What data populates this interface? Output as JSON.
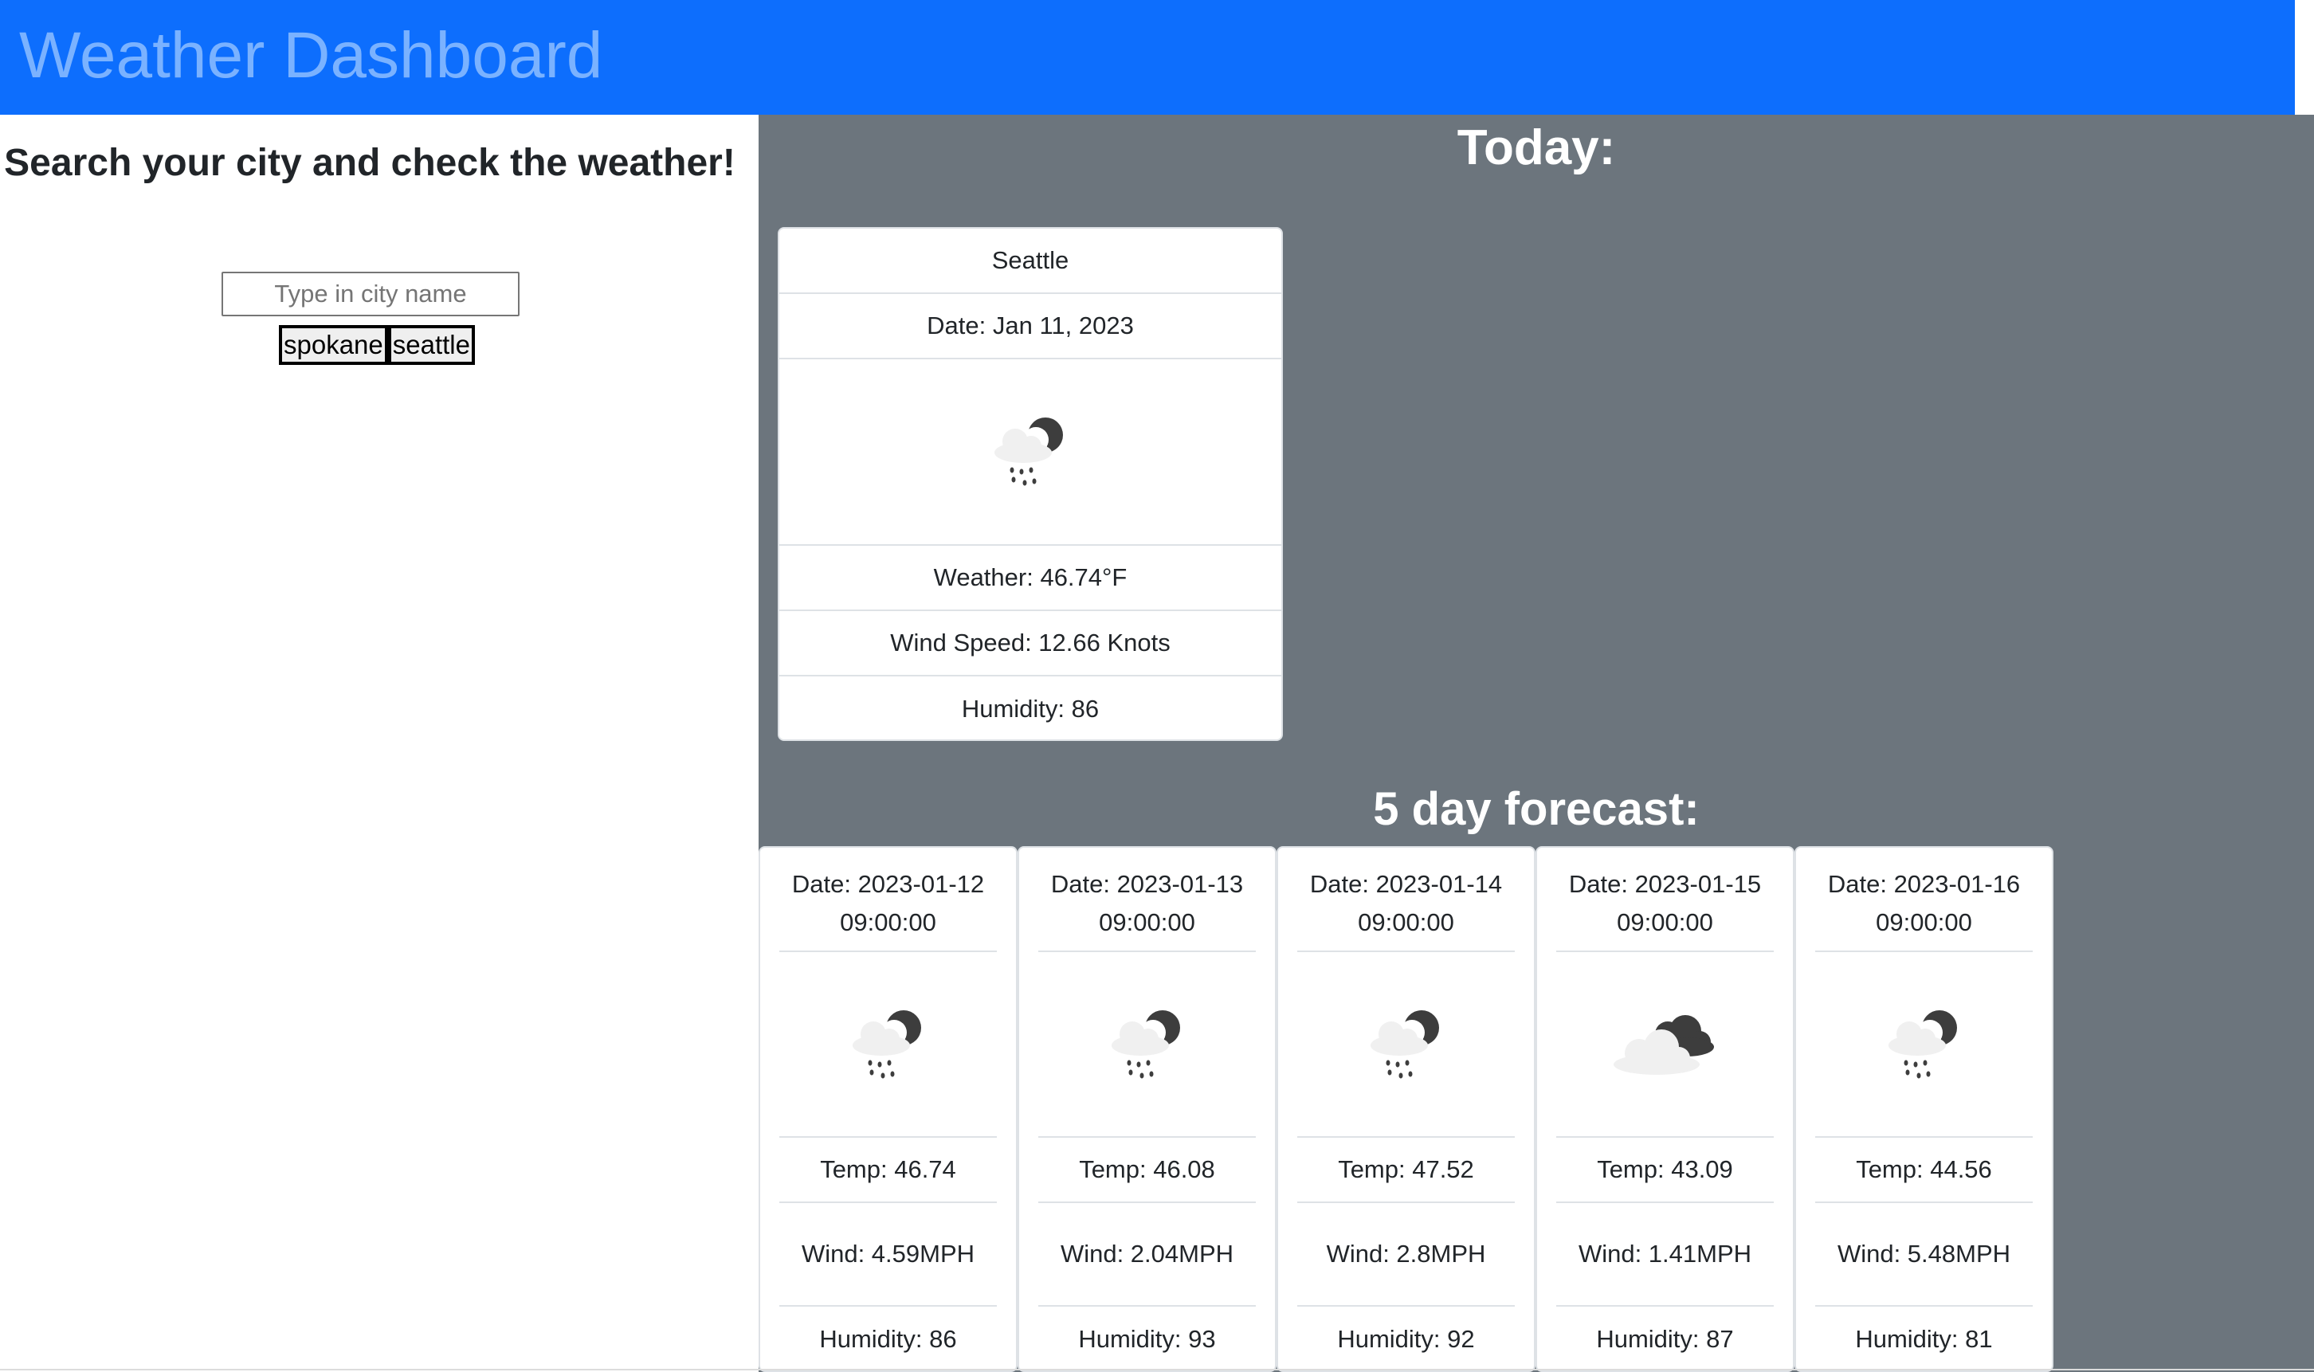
{
  "header": {
    "title": "Weather Dashboard"
  },
  "search": {
    "heading": "Search your city and check the weather!",
    "placeholder": "Type in city name",
    "history": [
      "spokane",
      "seattle"
    ]
  },
  "today": {
    "title": "Today:",
    "city": "Seattle",
    "date": "Date: Jan 11, 2023",
    "icon": "rain-night-icon",
    "weather": "Weather: 46.74°F",
    "wind": "Wind Speed: 12.66 Knots",
    "humidity": "Humidity: 86"
  },
  "forecast": {
    "title": "5 day forecast:",
    "days": [
      {
        "date": "Date: 2023-01-12 09:00:00",
        "icon": "rain-night-icon",
        "temp": "Temp: 46.74",
        "wind_value": "Wind: 4.59",
        "wind_unit": "MPH",
        "humidity": "Humidity: 86"
      },
      {
        "date": "Date: 2023-01-13 09:00:00",
        "icon": "rain-night-icon",
        "temp": "Temp: 46.08",
        "wind_value": "Wind: 2.04",
        "wind_unit": "MPH",
        "humidity": "Humidity: 93"
      },
      {
        "date": "Date: 2023-01-14 09:00:00",
        "icon": "rain-night-icon",
        "temp": "Temp: 47.52",
        "wind_value": "Wind: 2.8",
        "wind_unit": "MPH",
        "humidity": "Humidity: 92"
      },
      {
        "date": "Date: 2023-01-15 09:00:00",
        "icon": "broken-clouds-icon",
        "temp": "Temp: 43.09",
        "wind_value": "Wind: 1.41",
        "wind_unit": "MPH",
        "humidity": "Humidity: 87"
      },
      {
        "date": "Date: 2023-01-16 09:00:00",
        "icon": "rain-night-icon",
        "temp": "Temp: 44.56",
        "wind_value": "Wind: 5.48",
        "wind_unit": "MPH",
        "humidity": "Humidity: 81"
      }
    ]
  },
  "colors": {
    "header_bg": "#0d6efd",
    "header_text": "#7ab2ff",
    "panel_bg": "#6c757d"
  }
}
